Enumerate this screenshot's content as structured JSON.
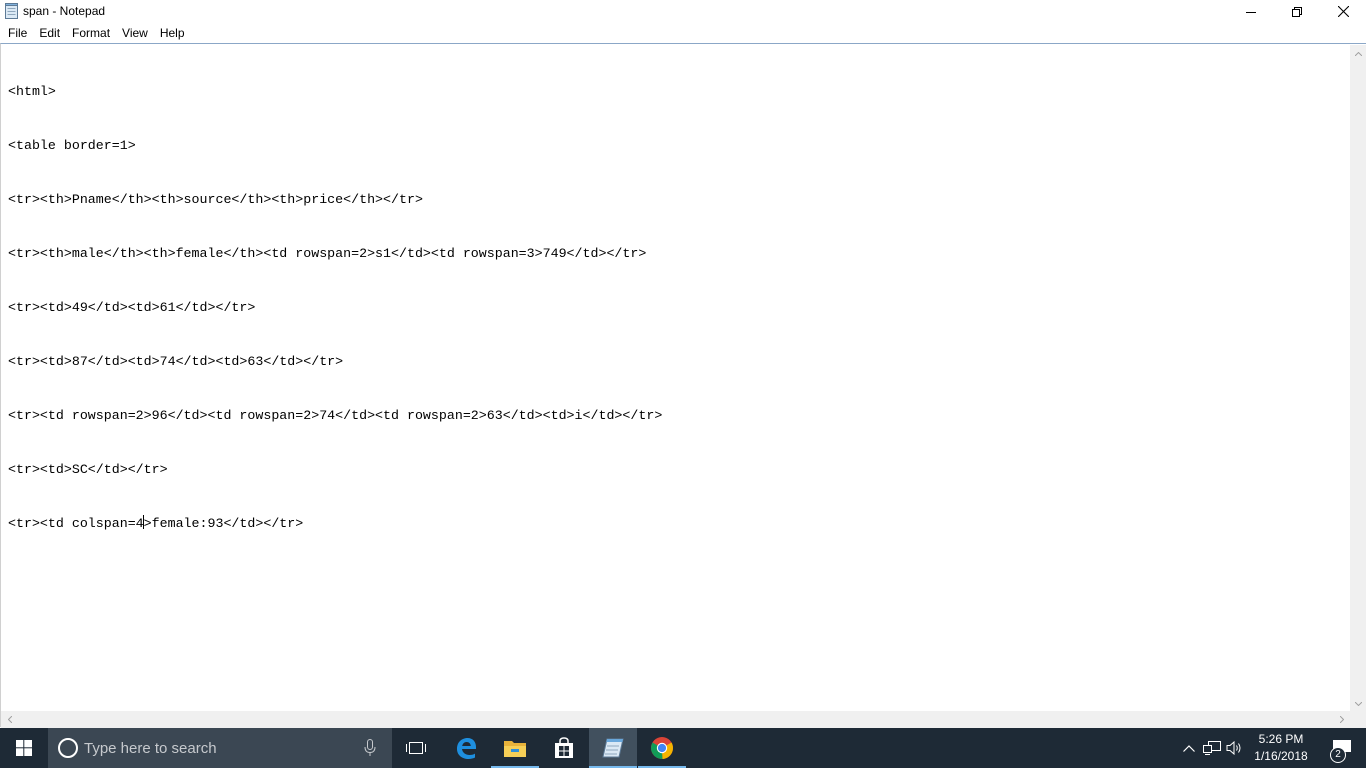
{
  "window": {
    "title": "span - Notepad",
    "icon": "notepad-icon",
    "controls": [
      "minimize-icon",
      "restore-icon",
      "close-icon"
    ]
  },
  "menu": {
    "items": [
      {
        "label": "File"
      },
      {
        "label": "Edit"
      },
      {
        "label": "Format"
      },
      {
        "label": "View"
      },
      {
        "label": "Help"
      }
    ]
  },
  "editor": {
    "lines": [
      {
        "text": "<html>"
      },
      {
        "text": "<table border=1>"
      },
      {
        "text": "<tr><th>Pname</th><th>source</th><th>price</th></tr>"
      },
      {
        "text": "<tr><th>male</th><th>female</th><td rowspan=2>s1</td><td rowspan=3>749</td></tr>"
      },
      {
        "text": "<tr><td>49</td><td>61</td></tr>"
      },
      {
        "text": "<tr><td>87</td><td>74</td><td>63</td></tr>"
      },
      {
        "text": "<tr><td rowspan=2>96</td><td rowspan=2>74</td><td rowspan=2>63</td><td>i</td></tr>"
      },
      {
        "text": "<tr><td>SC</td></tr>"
      }
    ],
    "caret_line": {
      "before": "<tr><td colspan=4",
      "after": ">female:93</td></tr>"
    }
  },
  "taskbar": {
    "search_placeholder": "Type here to search",
    "pinned": [
      "task-view-icon",
      "edge-icon",
      "file-explorer-icon",
      "store-icon",
      "notepad-icon",
      "chrome-icon"
    ],
    "active_app": "notepad",
    "tray_icons": [
      "chevron-up-icon",
      "network-icon",
      "volume-icon"
    ],
    "clock": {
      "time": "5:26 PM",
      "date": "1/16/2018"
    },
    "notification_count": "2"
  },
  "colors": {
    "taskbar": "#1e2a36",
    "search_box": "#3b4753",
    "active_indicator": "#76b9ed",
    "editor_border": "#8ba7c7"
  }
}
